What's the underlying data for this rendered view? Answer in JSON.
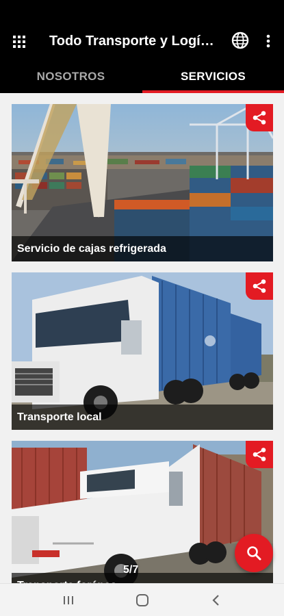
{
  "app_bar": {
    "title": "Todo Transporte y Logística",
    "icons": [
      "grid-menu-icon",
      "globe-icon",
      "more-vert-icon"
    ],
    "background": "#000000"
  },
  "tabs": [
    {
      "label": "NOSOTROS",
      "selected": false
    },
    {
      "label": "SERVICIOS",
      "selected": true
    }
  ],
  "accent_color": "#e31b23",
  "cards": [
    {
      "title": "Servicio de cajas refrigerada",
      "image": "shipping-container-port-photo",
      "action": "share-icon"
    },
    {
      "title": "Transporte local",
      "image": "white-semi-truck-with-blue-containers-photo",
      "action": "share-icon"
    },
    {
      "title": "Transporte foráneo",
      "image": "white-semi-truck-with-red-container-photo",
      "action": "share-icon"
    }
  ],
  "pager": "5/7",
  "fab": {
    "icon": "search-icon"
  },
  "system_nav": [
    "recents-icon",
    "home-icon",
    "back-icon"
  ]
}
